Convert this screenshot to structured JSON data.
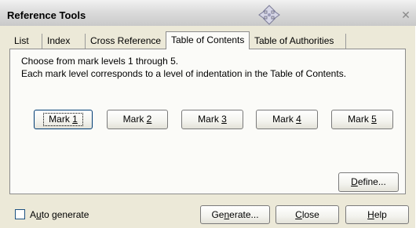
{
  "window": {
    "title": "Reference Tools",
    "close_glyph": "✕"
  },
  "tabs": [
    {
      "label": "List",
      "active": false
    },
    {
      "label": "Index",
      "active": false
    },
    {
      "label": "Cross Reference",
      "active": false
    },
    {
      "label": "Table of Contents",
      "active": true
    },
    {
      "label": "Table of Authorities",
      "active": false
    }
  ],
  "panel": {
    "line1": "Choose from mark levels 1 through 5.",
    "line2": "Each mark level corresponds to a level of indentation in the Table of Contents.",
    "mark_buttons": [
      {
        "text": "Mark ",
        "key": "1"
      },
      {
        "text": "Mark ",
        "key": "2"
      },
      {
        "text": "Mark ",
        "key": "3"
      },
      {
        "text": "Mark ",
        "key": "4"
      },
      {
        "text": "Mark ",
        "key": "5"
      }
    ],
    "define": {
      "key": "D",
      "rest": "efine..."
    }
  },
  "bottom": {
    "auto_generate": {
      "pre": "A",
      "key": "u",
      "rest": "to generate",
      "checked": false
    },
    "generate": {
      "pre": "Ge",
      "key": "n",
      "rest": "erate..."
    },
    "close": {
      "pre": "",
      "key": "C",
      "rest": "lose"
    },
    "help": {
      "pre": "",
      "key": "H",
      "rest": "elp"
    }
  },
  "icons": {
    "move": "move-cursor-icon"
  }
}
